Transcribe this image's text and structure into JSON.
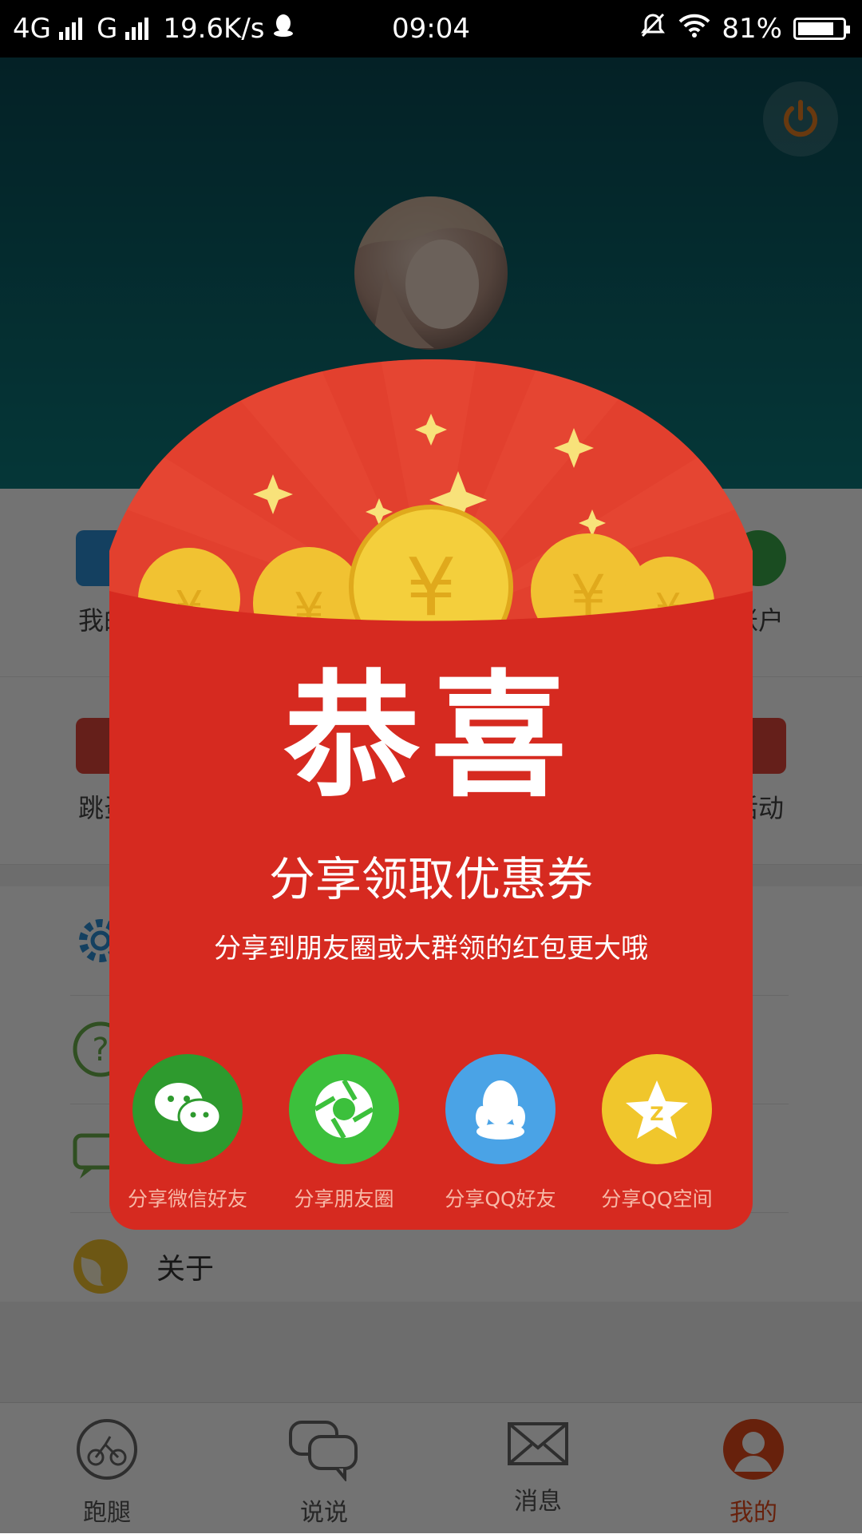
{
  "status_bar": {
    "network1": "4G",
    "network2": "G",
    "speed": "19.6K/s",
    "time": "09:04",
    "battery": "81%",
    "battery_level": 0.81
  },
  "grid": {
    "row1_left": "我的",
    "row1_right": "账户",
    "row2_left": "跳蚤",
    "row2_right": "活动"
  },
  "list": {
    "about": "关于"
  },
  "tabs": [
    {
      "label": "跑腿"
    },
    {
      "label": "说说"
    },
    {
      "label": "消息"
    },
    {
      "label": "我的"
    }
  ],
  "popup": {
    "title": "恭喜",
    "subtitle": "分享领取优惠券",
    "description": "分享到朋友圈或大群领的红包更大哦",
    "share": [
      {
        "label": "分享微信好友",
        "color": "#2e9a2e",
        "icon": "wechat-icon"
      },
      {
        "label": "分享朋友圈",
        "color": "#3cc03c",
        "icon": "moments-icon"
      },
      {
        "label": "分享QQ好友",
        "color": "#4aa3e6",
        "icon": "qq-icon"
      },
      {
        "label": "分享QQ空间",
        "color": "#f0c62c",
        "icon": "qzone-icon"
      }
    ]
  },
  "colors": {
    "accent": "#e44b1c",
    "envelope_red": "#d62a20",
    "header_teal": "#0d7a7c"
  }
}
